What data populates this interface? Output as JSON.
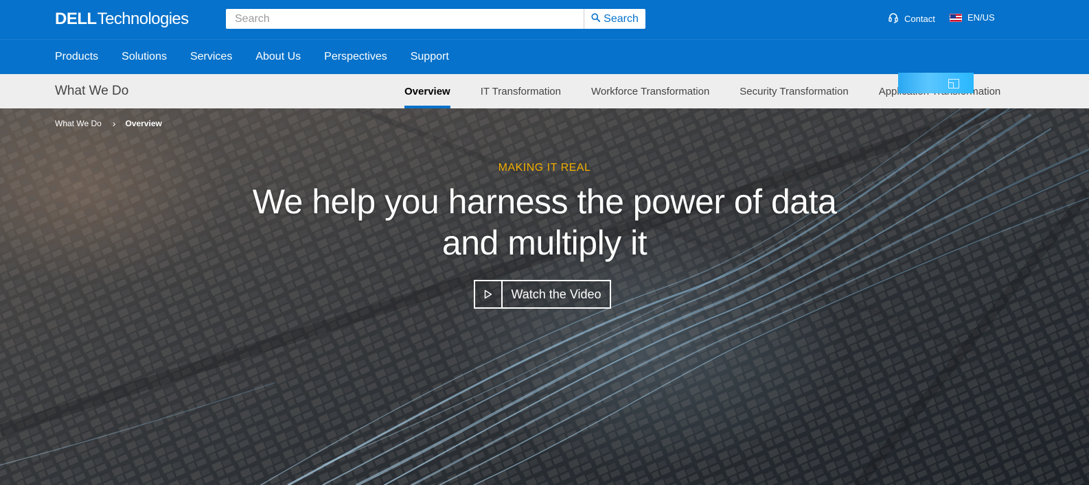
{
  "header": {
    "logo": {
      "brand": "DELL",
      "suffix": "Technologies"
    },
    "search": {
      "placeholder": "Search",
      "button_label": "Search"
    },
    "contact_label": "Contact",
    "locale_label": "EN/US"
  },
  "main_nav": {
    "items": [
      {
        "label": "Products"
      },
      {
        "label": "Solutions"
      },
      {
        "label": "Services"
      },
      {
        "label": "About Us"
      },
      {
        "label": "Perspectives"
      },
      {
        "label": "Support"
      }
    ]
  },
  "sub_nav": {
    "title": "What We Do",
    "tabs": [
      {
        "label": "Overview",
        "active": true
      },
      {
        "label": "IT Transformation",
        "active": false
      },
      {
        "label": "Workforce Transformation",
        "active": false
      },
      {
        "label": "Security Transformation",
        "active": false
      },
      {
        "label": "Application Transformation",
        "active": false
      }
    ]
  },
  "hero": {
    "breadcrumb": {
      "parent": "What We Do",
      "current": "Overview"
    },
    "eyebrow": "MAKING IT REAL",
    "headline_line1": "We help you harness the power of data",
    "headline_line2": "and multiply it",
    "cta_label": "Watch the Video"
  },
  "colors": {
    "brand_blue": "#0672cb",
    "eyebrow_yellow": "#f2af00",
    "subnav_bg": "#eeeeee"
  },
  "icons": [
    "search-icon",
    "headset-icon",
    "us-flag-icon",
    "chevron-right-icon",
    "play-icon"
  ]
}
